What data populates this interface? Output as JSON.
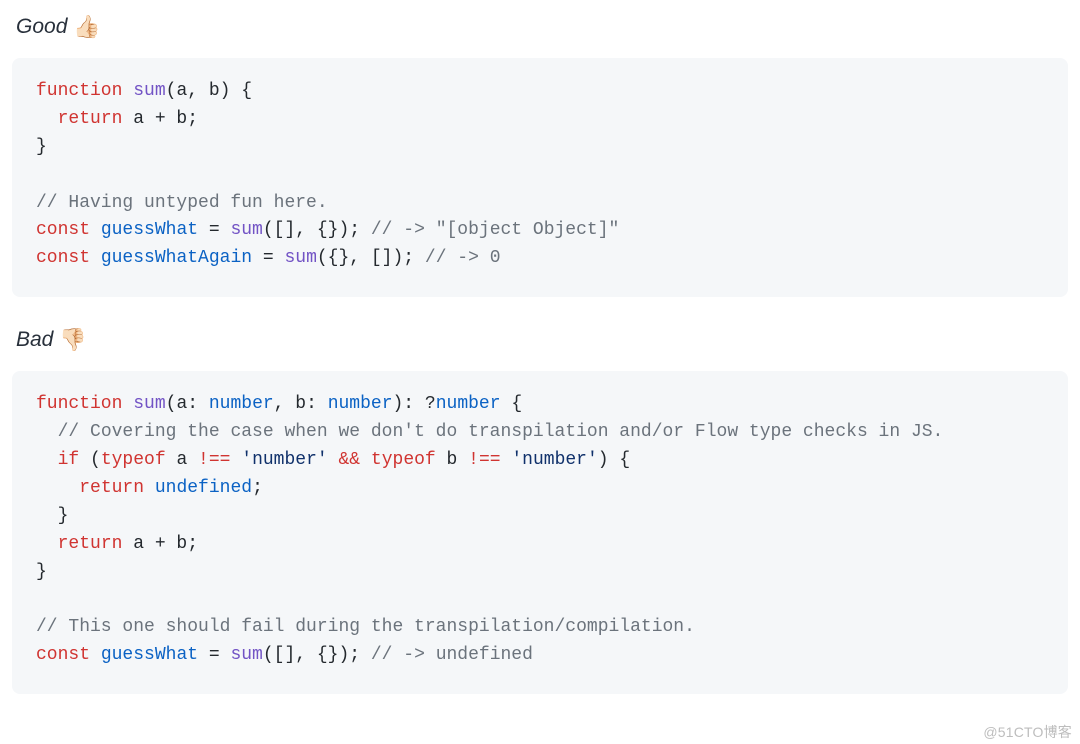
{
  "good": {
    "label": "Good",
    "emoji": "👍🏻",
    "code": {
      "l1": {
        "kw_function": "function",
        "fn": "sum",
        "sig": "(a, b) {"
      },
      "l2": {
        "kw_return": "return",
        "expr": " a + b;"
      },
      "l3": {
        "brace": "}"
      },
      "l4": {
        "comment": "// Having untyped fun here."
      },
      "l5": {
        "kw_const": "const",
        "id": "guessWhat",
        "assign": " = ",
        "fn": "sum",
        "args": "([], {});",
        "comment": " // -> \"[object Object]\""
      },
      "l6": {
        "kw_const": "const",
        "id": "guessWhatAgain",
        "assign": " = ",
        "fn": "sum",
        "args": "({}, []);",
        "comment": " // -> 0"
      }
    }
  },
  "bad": {
    "label": "Bad",
    "emoji": "👎🏻",
    "code": {
      "l1": {
        "kw_function": "function",
        "fn": "sum",
        "open": "(a: ",
        "t1": "number",
        "mid": ", b: ",
        "t2": "number",
        "close": "): ?",
        "t3": "number",
        "brace": " {"
      },
      "l2": {
        "comment": "// Covering the case when we don't do transpilation and/or Flow type checks in JS."
      },
      "l3": {
        "kw_if": "if",
        "open": " (",
        "kw_typeof1": "typeof",
        "a": " a ",
        "op1": "!==",
        "sp1": " ",
        "str1": "'number'",
        "sp2": " ",
        "op_and": "&&",
        "sp3": " ",
        "kw_typeof2": "typeof",
        "b": " b ",
        "op2": "!==",
        "sp4": " ",
        "str2": "'number'",
        "close": ") {"
      },
      "l4": {
        "kw_return": "return",
        "sp": " ",
        "undef": "undefined",
        "semi": ";"
      },
      "l5": {
        "brace": "}"
      },
      "l6": {
        "kw_return": "return",
        "expr": " a + b;"
      },
      "l7": {
        "brace": "}"
      },
      "l8": {
        "comment": "// This one should fail during the transpilation/compilation."
      },
      "l9": {
        "kw_const": "const",
        "id": "guessWhat",
        "assign": " = ",
        "fn": "sum",
        "args": "([], {});",
        "comment": " // -> undefined"
      }
    }
  },
  "watermark": "@51CTO博客"
}
